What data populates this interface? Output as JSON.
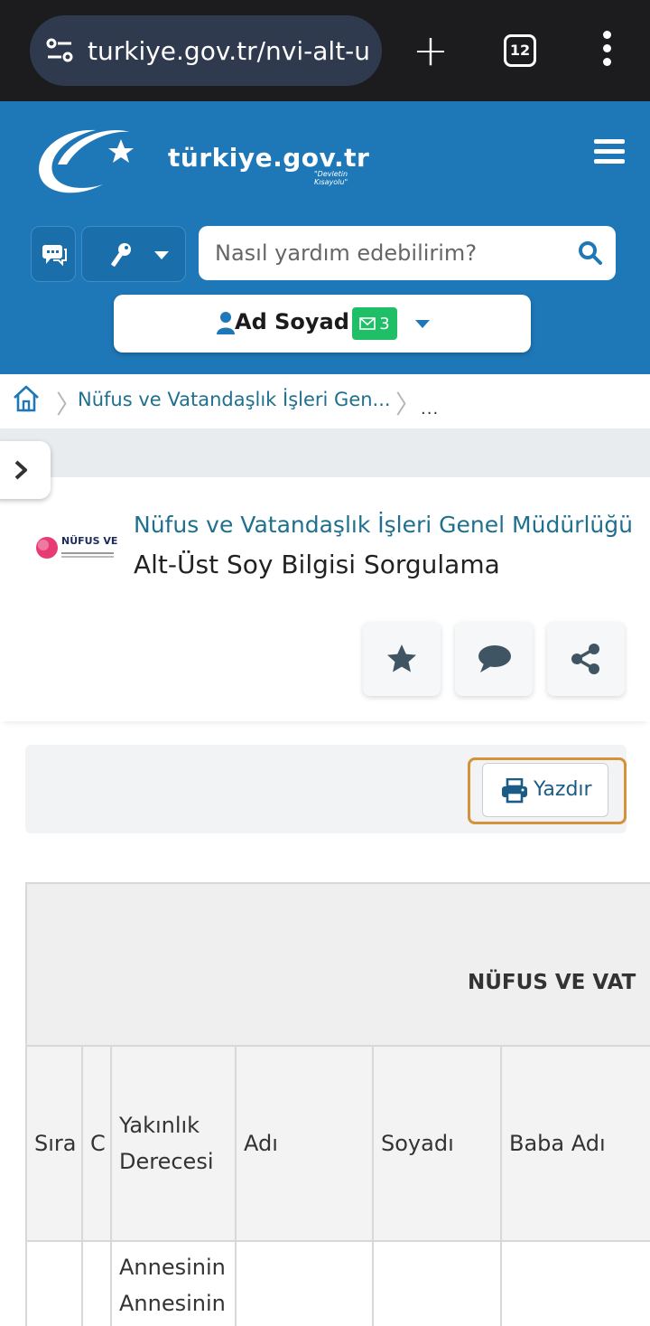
{
  "browser": {
    "url": "turkiye.gov.tr/nvi-alt-u",
    "tab_count": "12"
  },
  "header": {
    "logo_text": "türkiye.gov.tr",
    "logo_tagline": "\"Devletin Kısayolu\"",
    "search_placeholder": "Nasıl yardım edebilirim?",
    "user_name": "Ad Soyad",
    "message_count": "3"
  },
  "breadcrumb": {
    "items": [
      "Nüfus ve Vatandaşlık İşleri Gen...",
      "..."
    ]
  },
  "service": {
    "org_logo_text": "NÜFUS VE",
    "org_name": "Nüfus ve Vatandaşlık İşleri Genel Müdürlüğü",
    "title": "Alt-Üst Soy Bilgisi Sorgulama"
  },
  "toolbar": {
    "print_label": "Yazdır"
  },
  "table": {
    "caption": "NÜFUS VE VAT",
    "columns": [
      "Sıra",
      "C",
      "Yakınlık Derecesi",
      "Adı",
      "Soyadı",
      "Baba Adı"
    ],
    "rows": [
      {
        "sira": "",
        "c": "",
        "yakinlik": "Annesinin Annesinin",
        "adi": "",
        "soyadi": "",
        "baba_adi": ""
      }
    ]
  },
  "colors": {
    "header_blue": "#1e78b8",
    "link_teal": "#1f6f8f",
    "badge_green": "#1fbf68",
    "highlight_orange": "#d4923a"
  }
}
